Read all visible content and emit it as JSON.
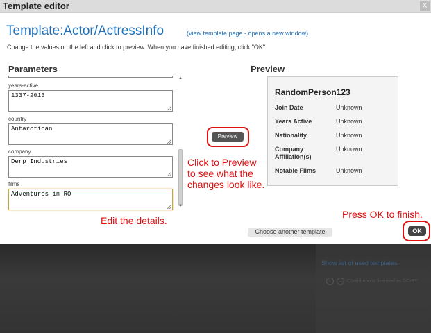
{
  "dialog": {
    "title": "Template editor",
    "close_label": "X",
    "template_name": "Template:Actor/ActressInfo",
    "template_link": "(view template page - opens a new window)",
    "instructions": "Change the values on the left and click to preview. When you have finished editing, click \"OK\"."
  },
  "parameters": {
    "heading": "Parameters",
    "fields": [
      {
        "label": "years-active",
        "value": "1337-2013"
      },
      {
        "label": "country",
        "value": "Antarctican"
      },
      {
        "label": "company",
        "value": "Derp Industries"
      },
      {
        "label": "films",
        "value": "Adventures in RO"
      }
    ]
  },
  "preview_button": "Preview",
  "preview": {
    "heading": "Preview",
    "name": "RandomPerson123",
    "rows": [
      {
        "key": "Join Date",
        "value": "Unknown"
      },
      {
        "key": "Years Active",
        "value": "Unknown"
      },
      {
        "key": "Nationality",
        "value": "Unknown"
      },
      {
        "key": "Company Affiliation(s)",
        "value": "Unknown"
      },
      {
        "key": "Notable Films",
        "value": "Unknown"
      }
    ]
  },
  "annotations": {
    "preview_hint": "Click to Preview to see what the changes look like.",
    "edit_hint": "Edit the details.",
    "ok_hint": "Press OK to finish."
  },
  "footer": {
    "choose_template": "Choose another template",
    "ok": "OK"
  },
  "background": {
    "link": "Show list of used templates",
    "license": "Contributions licensed as CC-BY"
  },
  "colors": {
    "accent": "#2070b8",
    "annotation": "#e01010"
  }
}
